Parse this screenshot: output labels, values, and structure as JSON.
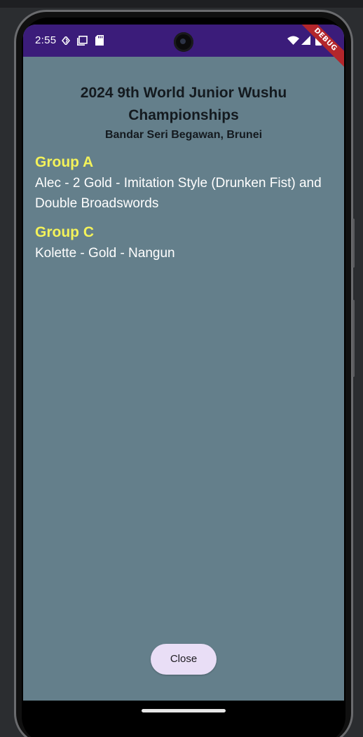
{
  "status_bar": {
    "time": "2:55",
    "left_icons": [
      "location-arrow-icon",
      "screen-icon",
      "sd-card-icon"
    ],
    "right_icons": [
      "wifi-icon",
      "cell-signal-icon",
      "battery-icon"
    ],
    "debug_label": "DEBUG",
    "background_color": "#3b1c7a"
  },
  "dialog": {
    "title": "2024 9th World Junior Wushu Championships",
    "subtitle": "Bandar Seri Begawan, Brunei",
    "groups": [
      {
        "name": "Group A",
        "lines": [
          "Alec - 2 Gold - Imitation Style (Drunken Fist) and Double Broadswords"
        ]
      },
      {
        "name": "Group C",
        "lines": [
          "Kolette - Gold - Nangun"
        ]
      }
    ],
    "close_label": "Close",
    "background_color": "#647f8b",
    "group_name_color": "#f3f25a"
  }
}
